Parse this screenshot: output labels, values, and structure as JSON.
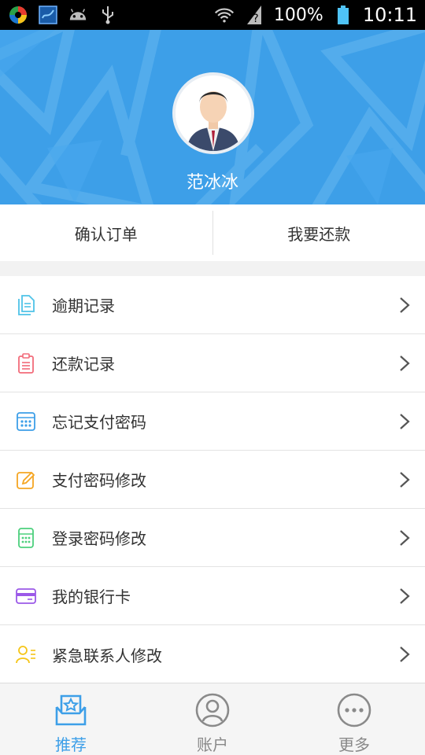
{
  "status_bar": {
    "battery": "100%",
    "time": "10:11",
    "icons": [
      "app-circle-icon",
      "app-square-icon",
      "android-icon",
      "usb-icon",
      "wifi-icon",
      "signal-unknown-icon",
      "battery-icon"
    ]
  },
  "profile": {
    "name": "范冰冰",
    "avatar": "avatar-icon"
  },
  "actions": {
    "confirm_order": "确认订单",
    "repay": "我要还款"
  },
  "menu": {
    "items": [
      {
        "label": "逾期记录",
        "icon": "document-icon",
        "color": "#4fc3e8"
      },
      {
        "label": "还款记录",
        "icon": "clipboard-icon",
        "color": "#f26b7a"
      },
      {
        "label": "忘记支付密码",
        "icon": "keypad-icon",
        "color": "#3d9fe8"
      },
      {
        "label": "支付密码修改",
        "icon": "edit-icon",
        "color": "#f5a623"
      },
      {
        "label": "登录密码修改",
        "icon": "phone-keypad-icon",
        "color": "#4cd07d"
      },
      {
        "label": "我的银行卡",
        "icon": "bank-card-icon",
        "color": "#9b59e8"
      },
      {
        "label": "紧急联系人修改",
        "icon": "contact-icon",
        "color": "#f5c518"
      }
    ]
  },
  "tabs": [
    {
      "label": "推荐",
      "icon": "recommend-icon",
      "active": true
    },
    {
      "label": "账户",
      "icon": "account-icon",
      "active": false
    },
    {
      "label": "更多",
      "icon": "more-icon",
      "active": false
    }
  ],
  "colors": {
    "accent": "#3d9fe8",
    "header_bg": "#3d9fe8"
  }
}
